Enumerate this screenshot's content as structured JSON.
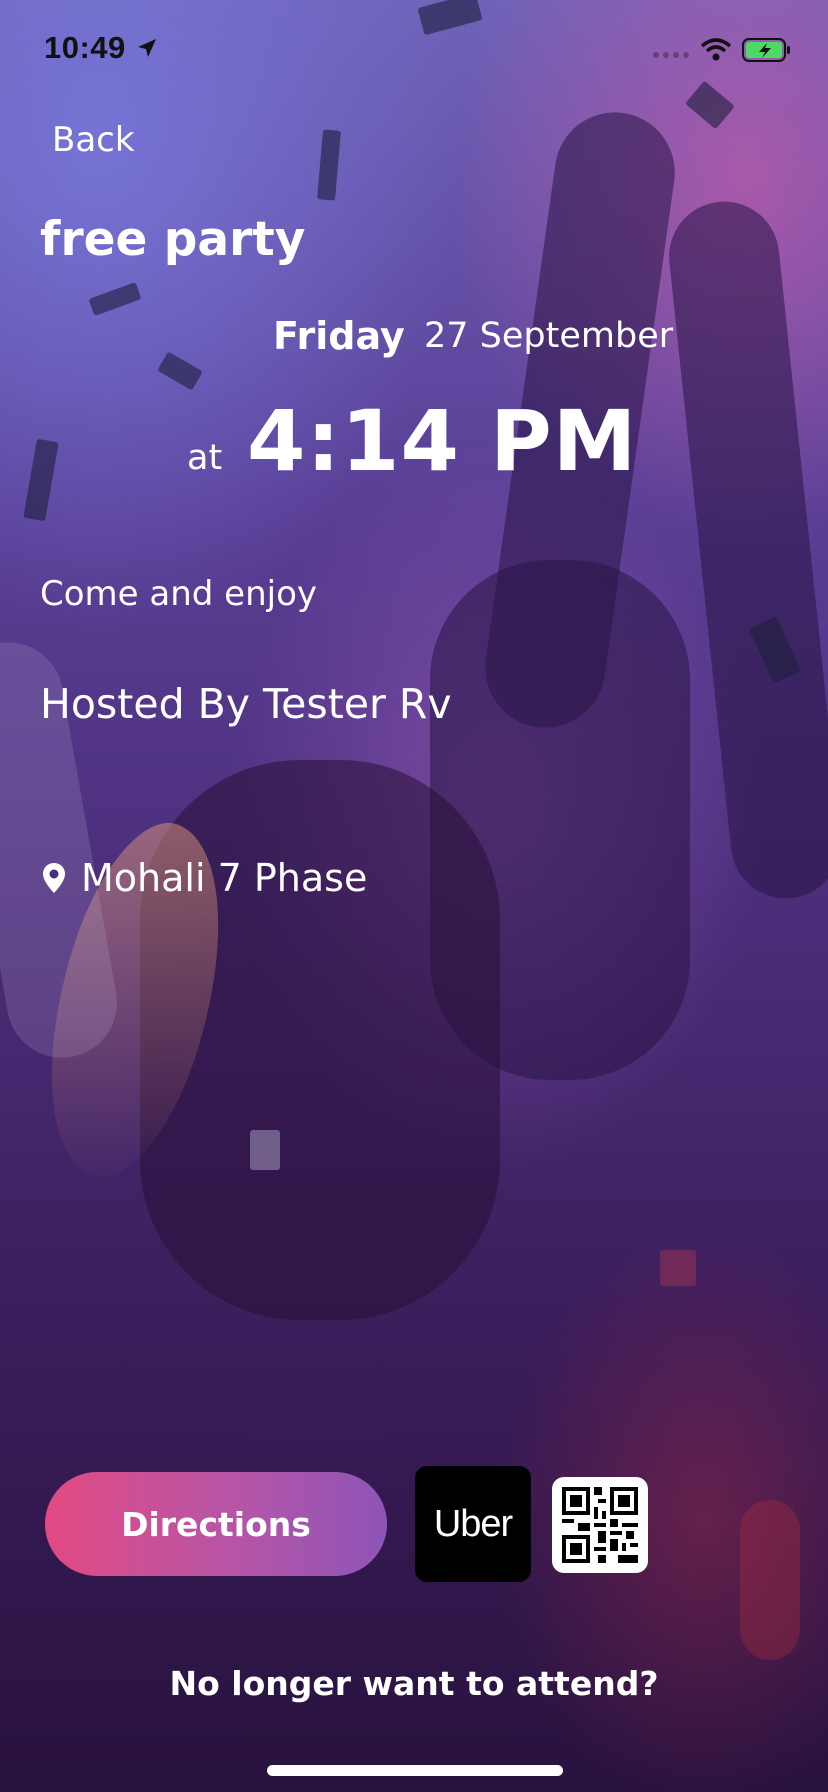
{
  "status_bar": {
    "time": "10:49"
  },
  "nav": {
    "back_label": "Back"
  },
  "event": {
    "title": "free party",
    "day": "Friday",
    "date": "27 September",
    "at_label": "at",
    "time": "4:14 PM",
    "description": "Come and enjoy",
    "host": "Hosted By Tester Rv",
    "location": "Mohali 7 Phase"
  },
  "actions": {
    "directions_label": "Directions",
    "uber_label": "Uber",
    "cancel_label": "No longer want to attend?"
  },
  "colors": {
    "directions_gradient_start": "#e24a82",
    "directions_gradient_end": "#8d55b8",
    "uber_bg": "#000000",
    "text": "#ffffff"
  },
  "icons": [
    "location-arrow-icon",
    "signal-icon",
    "wifi-icon",
    "battery-charging-icon",
    "location-pin-icon",
    "qr-code-icon"
  ]
}
